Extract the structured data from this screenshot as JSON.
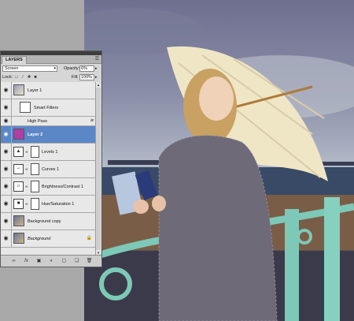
{
  "panel": {
    "tab": "LAYERS",
    "menu_icon": "panel-menu-icon",
    "blend_mode": "Screen",
    "opacity_label": "Opacity:",
    "opacity_value": "6%",
    "lock_label": "Lock:",
    "fill_label": "Fill:",
    "fill_value": "100%"
  },
  "layers": [
    {
      "name": "Layer 1",
      "kind": "smart-object"
    },
    {
      "name": "Smart Filters",
      "kind": "smart-filters"
    },
    {
      "name": "High Pass",
      "kind": "filter",
      "badge": "filter-options-icon"
    },
    {
      "name": "Layer 2",
      "kind": "color-layer",
      "selected": true,
      "color": "#b03ea3"
    },
    {
      "name": "Levels 1",
      "kind": "adjustment",
      "icon": "levels-icon"
    },
    {
      "name": "Curves 1",
      "kind": "adjustment",
      "icon": "curves-icon"
    },
    {
      "name": "Brightness/Contrast 1",
      "kind": "adjustment",
      "icon": "brightness-contrast-icon"
    },
    {
      "name": "Hue/Saturation 1",
      "kind": "adjustment",
      "icon": "hue-saturation-icon"
    },
    {
      "name": "Background copy",
      "kind": "image"
    },
    {
      "name": "Background",
      "kind": "background",
      "locked": true
    }
  ],
  "footer_icons": [
    "link-layers-icon",
    "fx-icon",
    "add-mask-icon",
    "adjustment-layer-icon",
    "group-folder-icon",
    "new-layer-icon",
    "trash-icon"
  ],
  "colors": {
    "selected": "#5b87c7",
    "panel": "#d6d6d6"
  }
}
